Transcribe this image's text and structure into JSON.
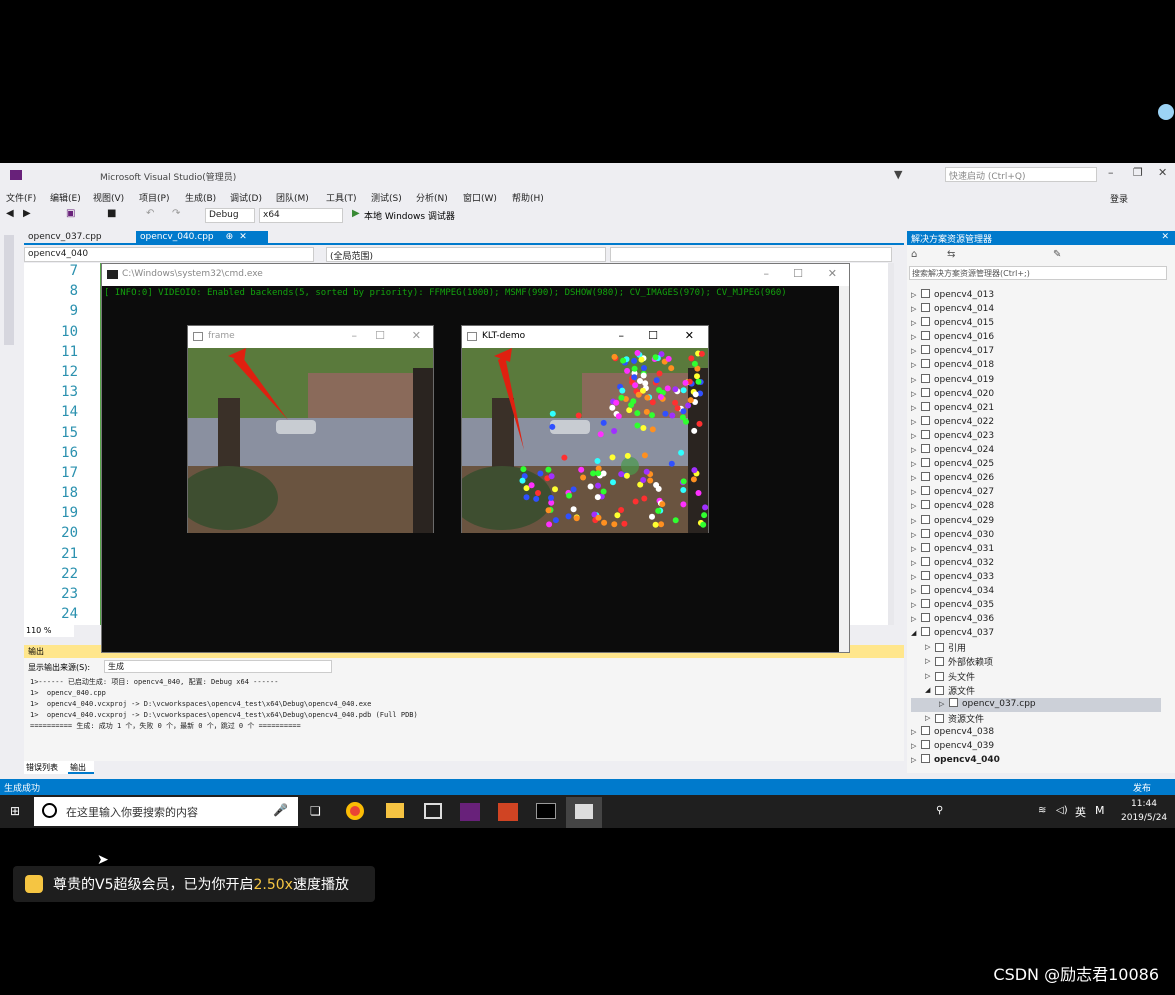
{
  "window": {
    "title": "Microsoft Visual Studio(管理员)",
    "quick_launch": "快速启动 (Ctrl+Q)",
    "login": "登录"
  },
  "menu": [
    "文件(F)",
    "编辑(E)",
    "视图(V)",
    "项目(P)",
    "生成(B)",
    "调试(D)",
    "团队(M)",
    "工具(T)",
    "测试(S)",
    "分析(N)",
    "窗口(W)",
    "帮助(H)"
  ],
  "toolbar": {
    "config": "Debug",
    "platform": "x64",
    "run_label": "本地 Windows 调试器"
  },
  "tabs": [
    {
      "label": "opencv_037.cpp"
    },
    {
      "label": "opencv_040.cpp"
    }
  ],
  "nav": {
    "project": "opencv4_040",
    "scope": "(全局范围)"
  },
  "editor": {
    "line_numbers": [
      "7",
      "8",
      "9",
      "10",
      "11",
      "12",
      "13",
      "14",
      "15",
      "16",
      "17",
      "18",
      "19",
      "20",
      "21",
      "22",
      "23",
      "24"
    ],
    "zoom": "110 %"
  },
  "cmd": {
    "title": "C:\\Windows\\system32\\cmd.exe",
    "text": "[ INFO:0] VIDEOIO: Enabled backends(5, sorted by priority): FFMPEG(1000); MSMF(990); DSHOW(980); CV_IMAGES(970); CV_MJPEG(960)"
  },
  "frame_window": {
    "title": "frame"
  },
  "klt_window": {
    "title": "KLT-demo"
  },
  "output": {
    "header": "输出",
    "source_label": "显示输出来源(S):",
    "source_value": "生成",
    "lines": [
      "1>------ 已启动生成: 项目: opencv4_040, 配置: Debug x64 ------",
      "1>  opencv_040.cpp",
      "1>  opencv4_040.vcxproj -> D:\\vcworkspaces\\opencv4_test\\x64\\Debug\\opencv4_040.exe",
      "1>  opencv4_040.vcxproj -> D:\\vcworkspaces\\opencv4_test\\x64\\Debug\\opencv4_040.pdb (Full PDB)",
      "========== 生成: 成功 1 个，失败 0 个，最新 0 个，跳过 0 个 =========="
    ],
    "tabs": [
      "错误列表",
      "输出"
    ]
  },
  "solution": {
    "title": "解决方案资源管理器",
    "search_placeholder": "搜索解决方案资源管理器(Ctrl+;)",
    "items": [
      "opencv4_013",
      "opencv4_014",
      "opencv4_015",
      "opencv4_016",
      "opencv4_017",
      "opencv4_018",
      "opencv4_019",
      "opencv4_020",
      "opencv4_021",
      "opencv4_022",
      "opencv4_023",
      "opencv4_024",
      "opencv4_025",
      "opencv4_026",
      "opencv4_027",
      "opencv4_028",
      "opencv4_029",
      "opencv4_030",
      "opencv4_031",
      "opencv4_032",
      "opencv4_033",
      "opencv4_034",
      "opencv4_035",
      "opencv4_036",
      "opencv4_037",
      "引用",
      "外部依赖项",
      "头文件",
      "源文件",
      "opencv_037.cpp",
      "资源文件",
      "opencv4_038",
      "opencv4_039",
      "opencv4_040"
    ]
  },
  "statusbar": {
    "left": "生成成功",
    "right": "发布"
  },
  "taskbar": {
    "search_placeholder": "在这里输入你要搜索的内容",
    "time": "11:44",
    "date": "2019/5/24",
    "ime": "英"
  },
  "overlay": {
    "badge_pre": "尊贵的V5超级会员，已为你开启",
    "badge_speed": "2.50x",
    "badge_post": "速度播放",
    "watermark": "CSDN @励志君10086"
  },
  "colors": {
    "accent": "#007acc",
    "console_text": "#13a10e",
    "badge_highlight": "#f5c542"
  }
}
